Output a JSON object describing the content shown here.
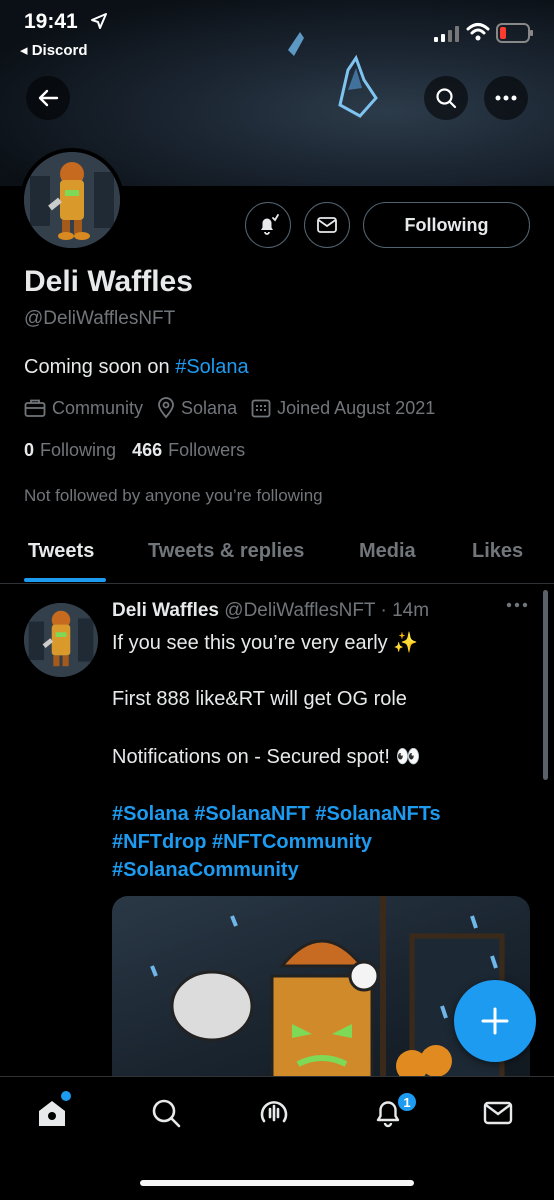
{
  "status_bar": {
    "time": "19:41",
    "back_app": "◂ Discord"
  },
  "profile": {
    "name": "Deli Waffles",
    "handle": "@DeliWafflesNFT",
    "bio_text": "Coming soon on ",
    "bio_tag": "#Solana",
    "category": "Community",
    "location": "Solana",
    "joined": "Joined August 2021",
    "following_count": "0",
    "following_label": "Following",
    "followers_count": "466",
    "followers_label": "Followers",
    "not_followed": "Not followed by anyone you’re following",
    "following_button": "Following"
  },
  "tabs": [
    {
      "label": "Tweets",
      "active": true
    },
    {
      "label": "Tweets & replies"
    },
    {
      "label": "Media"
    },
    {
      "label": "Likes"
    }
  ],
  "tweet": {
    "author": "Deli Waffles",
    "handle_time": "@DeliWafflesNFT · 14m",
    "line1": "If you see this you’re very early ✨",
    "line2": "First 888 like&RT will get OG role",
    "line3": "Notifications on - Secured spot! 👀",
    "tags1": "#Solana #SolanaNFT #SolanaNFTs",
    "tags2": "#NFTdrop #NFTCommunity",
    "tags3": "#SolanaCommunity"
  },
  "bottom_nav": {
    "notification_badge": "1"
  },
  "colors": {
    "accent": "#1d9bf0",
    "background": "#000000",
    "muted": "#71767b",
    "text": "#e7e9ea"
  }
}
